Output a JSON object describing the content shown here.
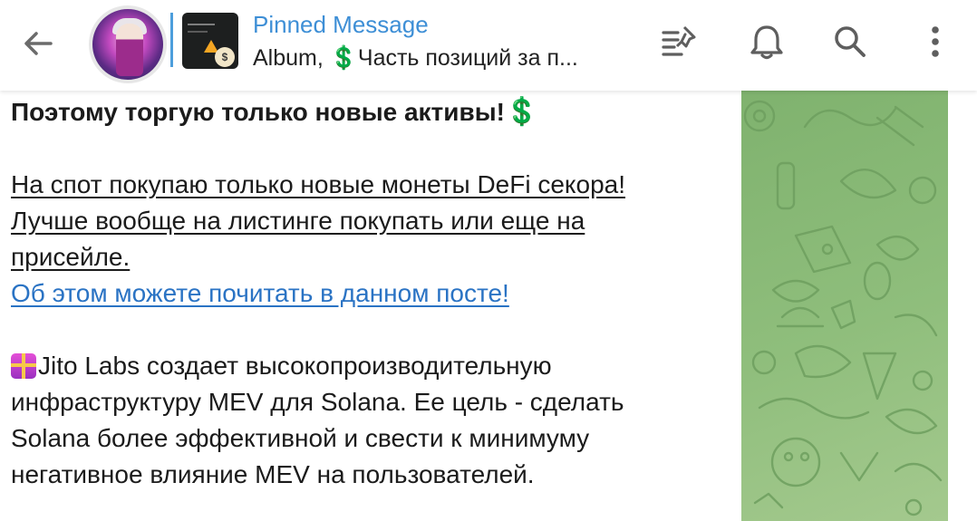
{
  "header": {
    "pinned_title": "Pinned Message",
    "pinned_preview_prefix": "Album, ",
    "pinned_preview_emoji": "💲",
    "pinned_preview_text": "Часть позиций за п...",
    "thumb_badge": "$"
  },
  "message": {
    "line_bold": "Поэтому торгую только новые активы!",
    "emoji_dollar": "💲",
    "underlined_lines": [
      "На спот покупаю только новые монеты DeFi секора!",
      "Лучше вообще на листинге покупать или еще на",
      "присейле."
    ],
    "link_text": "Об этом можете почитать в данном посте!",
    "jito_lines": [
      "Jito Labs создает высокопроизводительную",
      "инфраструктуру MEV для Solana. Ее цель - сделать",
      "Solana более эффективной и свести к минимуму",
      "негативное влияние MEV на пользователей."
    ]
  },
  "colors": {
    "accent": "#3e8fd6",
    "link": "#2a73c4",
    "wallpaper": "#8fbe7c",
    "dollar_green": "#1ea33a"
  },
  "icons": [
    "back-arrow-icon",
    "pinned-list-icon",
    "bell-icon",
    "search-icon",
    "more-vert-icon",
    "gift-icon"
  ]
}
